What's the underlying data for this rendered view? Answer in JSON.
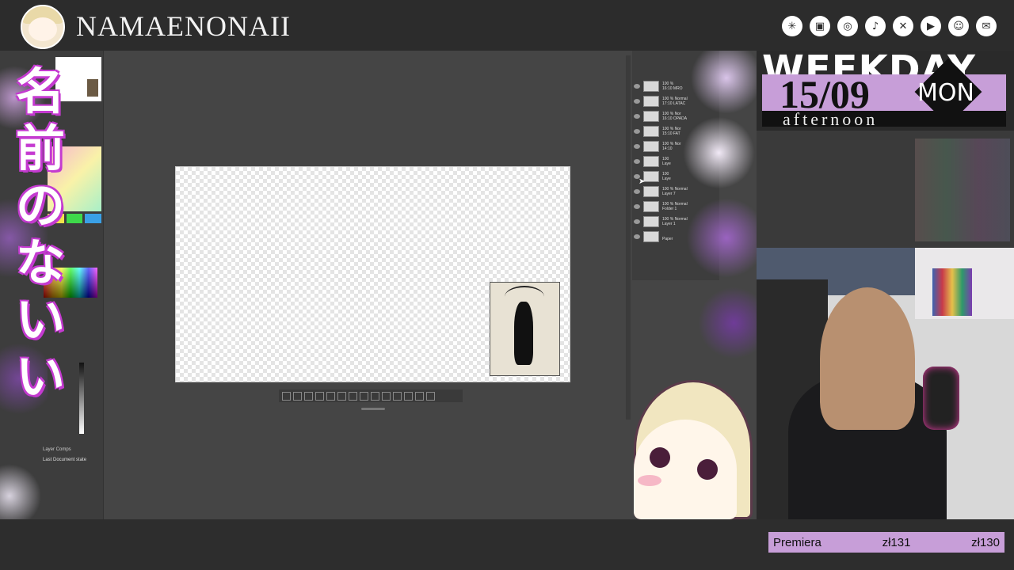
{
  "header": {
    "brand": "NAMAENONAII",
    "social_icons": [
      "linktree-icon",
      "twitch-icon",
      "instagram-icon",
      "tiktok-icon",
      "x-icon",
      "youtube-icon",
      "discord-icon",
      "mail-icon"
    ]
  },
  "overlay": {
    "vertical_title": [
      "名",
      "前",
      "の",
      "な",
      "い",
      "い"
    ]
  },
  "schedule": {
    "weekday": "WEEKDAY",
    "date": "15/09",
    "day": "MON",
    "time": "afternoon"
  },
  "layers": [
    {
      "blend": "100 %",
      "name": "16:10 MRO"
    },
    {
      "blend": "100 % Normal",
      "name": "17:10 LATAC"
    },
    {
      "blend": "100 % Nor",
      "name": "16:10 OPADA"
    },
    {
      "blend": "100 % Nor",
      "name": "15:10 FAT"
    },
    {
      "blend": "100 % Nor",
      "name": "14:10"
    },
    {
      "blend": "100",
      "name": "Laye"
    },
    {
      "blend": "100",
      "name": "Laye"
    },
    {
      "blend": "100 % Normal",
      "name": "Layer 7"
    },
    {
      "blend": "100 % Normal",
      "name": "Folder 1"
    },
    {
      "blend": "100 % Normal",
      "name": "Layer 1"
    },
    {
      "blend": "",
      "name": "Paper"
    }
  ],
  "left_panel": {
    "layer_comps_title": "Layer Comps",
    "layer_comps_row": "Last Document state"
  },
  "ticker": {
    "label": "Premiera",
    "value1": "zł131",
    "value2": "zł130"
  },
  "colors": {
    "accent": "#c79ed8",
    "brand_outline": "#c43ad0",
    "topbar": "#2c2c2c"
  }
}
